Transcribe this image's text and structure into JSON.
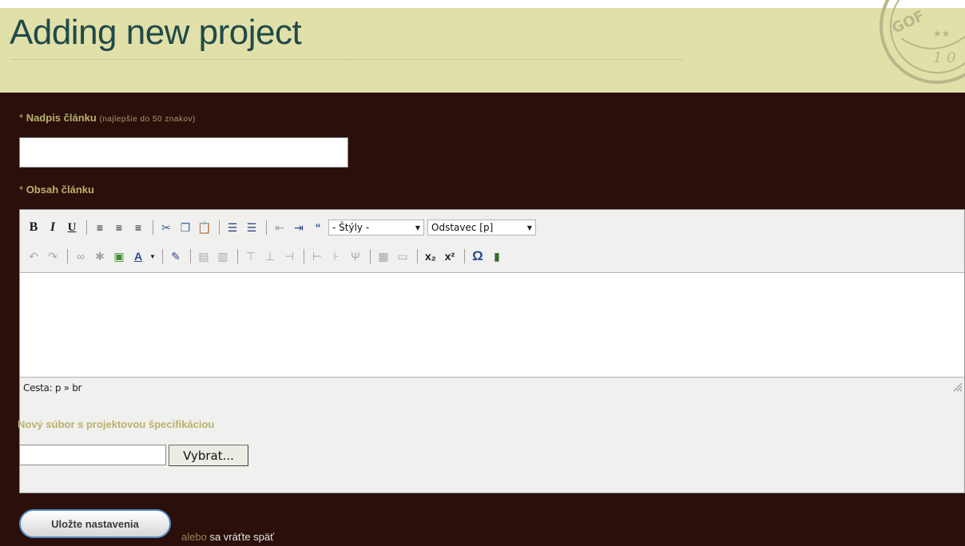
{
  "header": {
    "title": "Adding new project"
  },
  "form": {
    "title_label": "Nadpis článku",
    "title_hint": "(najlepšie do 50 znakov)",
    "required_mark": "*",
    "title_value": "",
    "content_label": "Obsah článku",
    "editor": {
      "styles_select": "- Štýly -",
      "format_select": "Odstavec [p]",
      "path_label": "Cesta: p » br",
      "toolbar1": [
        "bold-button",
        "italic-button",
        "underline-button",
        "align-left-button",
        "align-center-button",
        "align-right-button",
        "cut-button",
        "copy-button",
        "paste-button",
        "bullet-list-button",
        "numbered-list-button",
        "outdent-button",
        "indent-button",
        "blockquote-button"
      ],
      "toolbar2": [
        "undo-button",
        "redo-button",
        "link-button",
        "unlink-button",
        "image-button",
        "text-color-button",
        "edit-html-button",
        "table-button",
        "table-props-button",
        "insert-row-before-button",
        "insert-row-after-button",
        "delete-row-button",
        "insert-col-before-button",
        "insert-col-after-button",
        "delete-col-button",
        "split-cells-button",
        "merge-cells-button",
        "subscript-button",
        "superscript-button",
        "special-char-button",
        "media-button"
      ]
    },
    "file_label": "Nový súbor s projektovou špecifikáciou",
    "file_button": "Vybrat...",
    "save_button": "Uložte nastavenia",
    "or_text": "alebo",
    "back_link": "sa vráťte späť"
  },
  "colors": {
    "header_bg": "#e1e0a8",
    "page_bg": "#2a0f0b",
    "label": "#b9b26a",
    "title": "#1f4a4a"
  }
}
